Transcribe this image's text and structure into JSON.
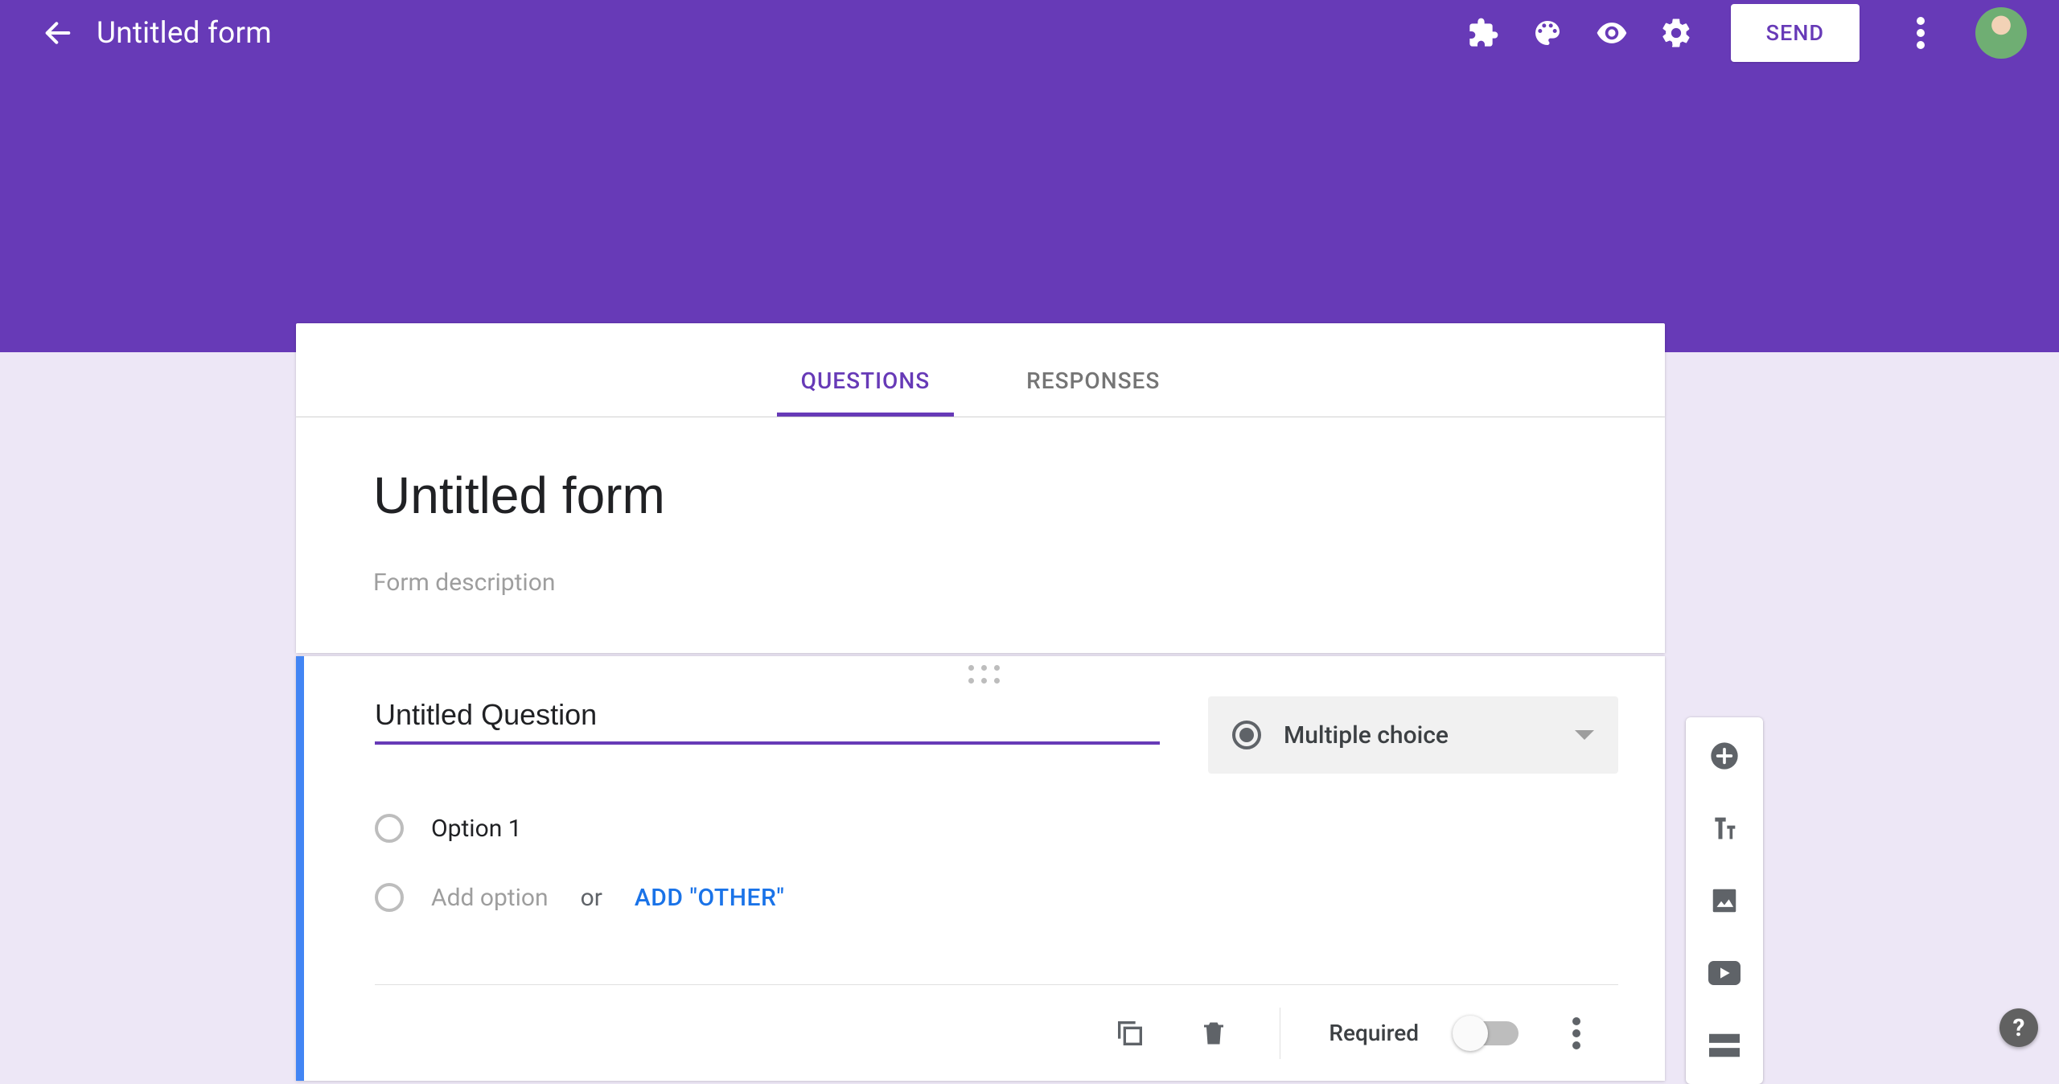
{
  "colors": {
    "primary": "#673ab7",
    "accent_blue": "#4285f4",
    "link_blue": "#1a73e8"
  },
  "header": {
    "title": "Untitled form",
    "send_label": "SEND"
  },
  "tabs": {
    "questions": "QUESTIONS",
    "responses": "RESPONSES",
    "active": "questions"
  },
  "form": {
    "title": "Untitled form",
    "description_placeholder": "Form description"
  },
  "question": {
    "title": "Untitled Question",
    "type_label": "Multiple choice",
    "options": [
      "Option 1"
    ],
    "add_option_placeholder": "Add option",
    "or_label": "or",
    "add_other_label": "ADD \"OTHER\"",
    "required_label": "Required",
    "required": false
  },
  "side_toolbar": {
    "items": [
      "add-question",
      "add-title",
      "add-image",
      "add-video",
      "add-section"
    ]
  }
}
